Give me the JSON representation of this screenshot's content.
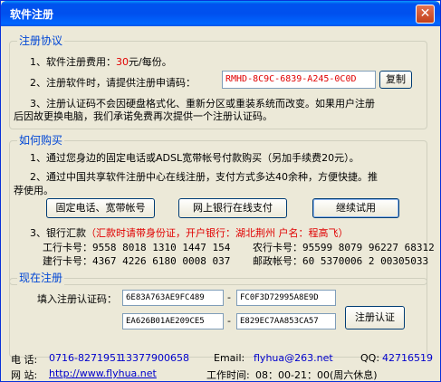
{
  "window": {
    "title": "软件注册",
    "close_glyph": "✕"
  },
  "agreement": {
    "legend": "注册协议",
    "line1_prefix": "1、软件注册费用：",
    "line1_price": "30",
    "line1_suffix": "元/每份。",
    "line2": "2、注册软件时，请提供注册申请码：",
    "request_code": "RMHD-8C9C-6839-A245-0C0D",
    "copy_button": "复制",
    "line3a": "3、注册认证码不会因硬盘格式化、重新分区或重装系统而改变。如果用户注册",
    "line3b": "后因故更换电脑，我们承诺免费再次提供一个注册认证码。"
  },
  "purchase": {
    "legend": "如何购买",
    "line1": "1、通过您身边的固定电话或ADSL宽带帐号付款购买（另加手续费20元）。",
    "line2a": "2、通过中国共享软件注册中心在线注册，支付方式多达40余种，方便快捷。推",
    "line2b": "荐使用。",
    "btn_phone": "固定电话、宽带帐号",
    "btn_online": "网上银行在线支付",
    "btn_trial": "继续试用",
    "line3_prefix": "3、银行汇款",
    "line3_note": "（汇款时请带身份证，开户银行：湖北荆州 户名：程高飞）",
    "banks": [
      {
        "label": "工行卡号：",
        "number": "9558 8018 1310 1447 154"
      },
      {
        "label": "农行卡号：",
        "number": "95599 8079 96227 68312"
      },
      {
        "label": "建行卡号：",
        "number": "4367 4226 6180 0008 037"
      },
      {
        "label": "邮政帐号：",
        "number": "60 5370006 2 00305033"
      }
    ]
  },
  "register": {
    "legend": "现在注册",
    "label": "填入注册认证码：",
    "code1": "6E83A763AE9FC489",
    "code2": "FC0F3D72995A8E9D",
    "code3": "EA626B01AE209CE5",
    "code4": "E829EC7AA853CA57",
    "dash": "-",
    "button": "注册认证"
  },
  "footer": {
    "phone_label": "电  话:",
    "phone1": "0716-8271951",
    "phone2": "13377900658",
    "email_label": "Email:",
    "email": "flyhua@263.net",
    "qq_label": "QQ:",
    "qq": "42716519",
    "site_label": "网  站:",
    "site": "http://www.flyhua.net",
    "hours_label": "工作时间:",
    "hours": "08：00-21：00(周六休息)"
  }
}
